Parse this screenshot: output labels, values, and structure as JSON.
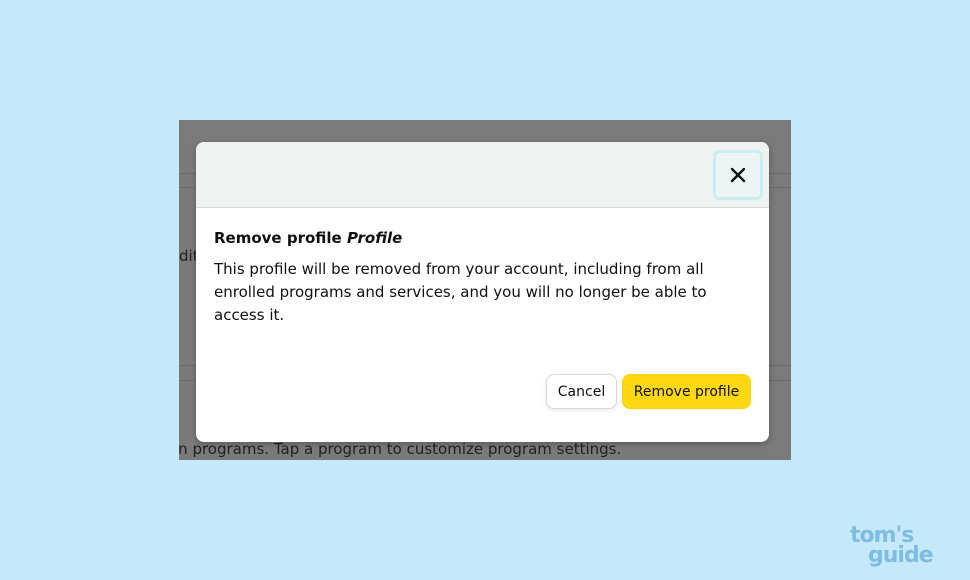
{
  "background_page": {
    "fragment_text": "diti",
    "description_text": "on programs. Tap a program to customize program settings."
  },
  "modal": {
    "close_icon": "close-x-icon",
    "title_prefix": "Remove profile",
    "profile_name": "Profile",
    "message": "This profile will be removed from your account, including from all enrolled programs and services, and you will no longer be able to access it.",
    "cancel_label": "Cancel",
    "remove_label": "Remove profile"
  },
  "watermark": {
    "line1": "tom's",
    "line2": "guide"
  },
  "colors": {
    "page_background": "#c5e8fb",
    "primary_button": "#ffd814",
    "close_focus_ring": "#c8eef2",
    "watermark": "#7fbde0"
  }
}
